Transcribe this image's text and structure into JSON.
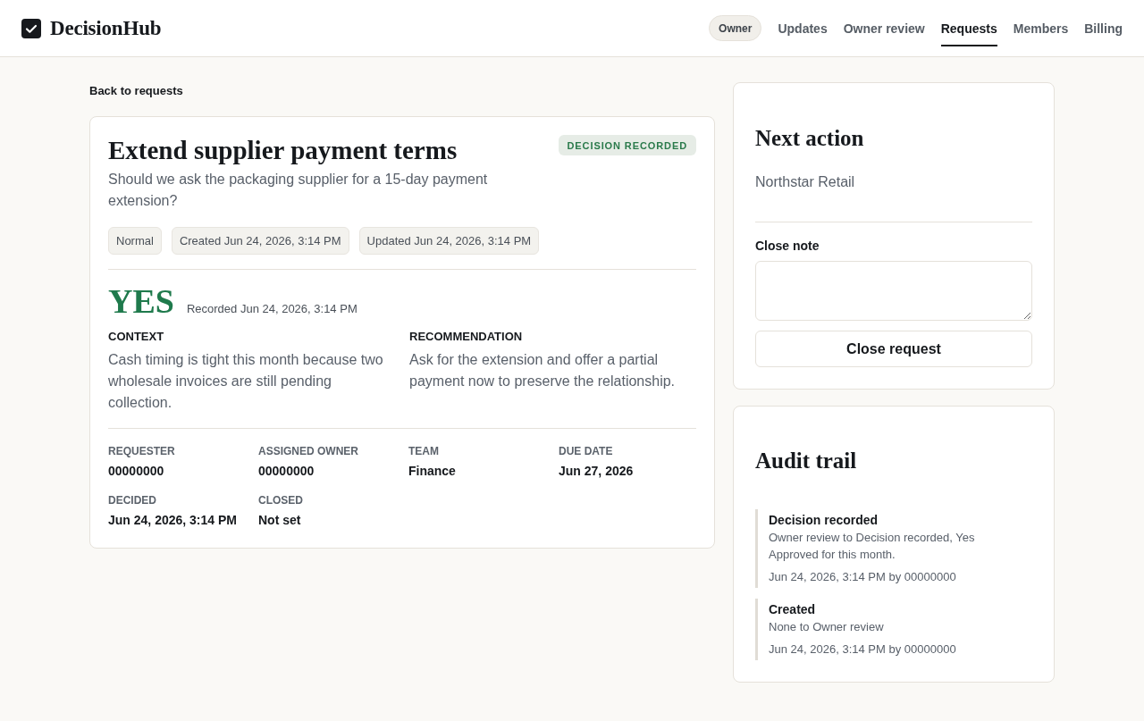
{
  "header": {
    "logo": "DecisionHub",
    "role": "Owner",
    "nav": [
      {
        "label": "Updates",
        "selected": false
      },
      {
        "label": "Owner review",
        "selected": false
      },
      {
        "label": "Requests",
        "selected": true
      },
      {
        "label": "Members",
        "selected": false
      },
      {
        "label": "Billing",
        "selected": false
      }
    ]
  },
  "back_link": "Back to requests",
  "request": {
    "title": "Extend supplier payment terms",
    "status": "DECISION RECORDED",
    "question": "Should we ask the packaging supplier for a 15-day payment extension?",
    "chips": [
      "Normal",
      "Created Jun 24, 2026, 3:14 PM",
      "Updated Jun 24, 2026, 3:14 PM"
    ],
    "decision": {
      "answer": "YES",
      "recorded": "Recorded Jun 24, 2026, 3:14 PM"
    },
    "sections": [
      {
        "label": "CONTEXT",
        "text": "Cash timing is tight this month because two wholesale invoices are still pending collection."
      },
      {
        "label": "RECOMMENDATION",
        "text": "Ask for the extension and offer a partial payment now to preserve the relationship."
      }
    ],
    "details": [
      {
        "label": "REQUESTER",
        "value": "00000000"
      },
      {
        "label": "ASSIGNED OWNER",
        "value": "00000000"
      },
      {
        "label": "TEAM",
        "value": "Finance"
      },
      {
        "label": "DUE DATE",
        "value": "Jun 27, 2026"
      },
      {
        "label": "DECIDED",
        "value": "Jun 24, 2026, 3:14 PM"
      },
      {
        "label": "CLOSED",
        "value": "Not set"
      }
    ]
  },
  "next_action": {
    "title": "Next action",
    "assignee": "Northstar Retail",
    "note_label": "Close note",
    "button": "Close request"
  },
  "audit_trail": {
    "title": "Audit trail",
    "entries": [
      {
        "title": "Decision recorded",
        "change": "Owner review to Decision recorded, Yes",
        "note": "Approved for this month.",
        "meta": "Jun 24, 2026, 3:14 PM by 00000000"
      },
      {
        "title": "Created",
        "change": "None to Owner review",
        "meta": "Jun 24, 2026, 3:14 PM by 00000000"
      }
    ]
  }
}
